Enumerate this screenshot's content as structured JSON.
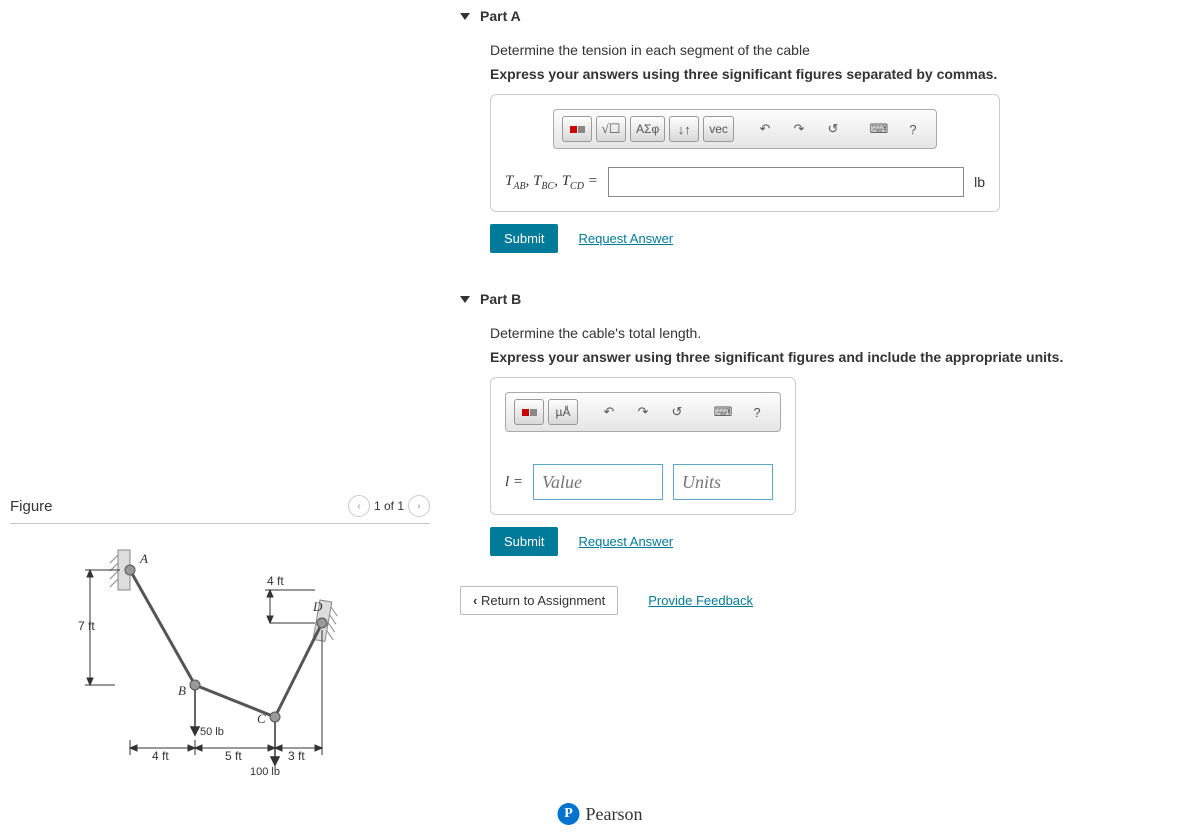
{
  "figure": {
    "title": "Figure",
    "counter": "1 of 1",
    "dims": {
      "vert": "7 ft",
      "top": "4 ft",
      "h1": "4 ft",
      "h2": "5 ft",
      "h3": "3 ft"
    },
    "nodes": {
      "A": "A",
      "B": "B",
      "C": "C",
      "D": "D"
    },
    "forces": {
      "b": "50 lb",
      "c": "100 lb"
    }
  },
  "partA": {
    "title": "Part A",
    "prompt": "Determine the tension in each segment of the cable",
    "instruction": "Express your answers using three significant figures separated by commas.",
    "var_html": "T<sub>AB</sub>, T<sub>BC</sub>, T<sub>CD</sub> =",
    "unit": "lb",
    "submit": "Submit",
    "request": "Request Answer",
    "toolbar": {
      "greek": "ΑΣφ",
      "vec": "vec",
      "help": "?"
    }
  },
  "partB": {
    "title": "Part B",
    "prompt": "Determine the cable's total length.",
    "instruction": "Express your answer using three significant figures and include the appropriate units.",
    "var_html": "l =",
    "value_ph": "Value",
    "units_ph": "Units",
    "submit": "Submit",
    "request": "Request Answer",
    "toolbar": {
      "units": "µÅ",
      "help": "?"
    }
  },
  "footer": {
    "return": "Return to Assignment",
    "feedback": "Provide Feedback",
    "brand": "Pearson"
  }
}
